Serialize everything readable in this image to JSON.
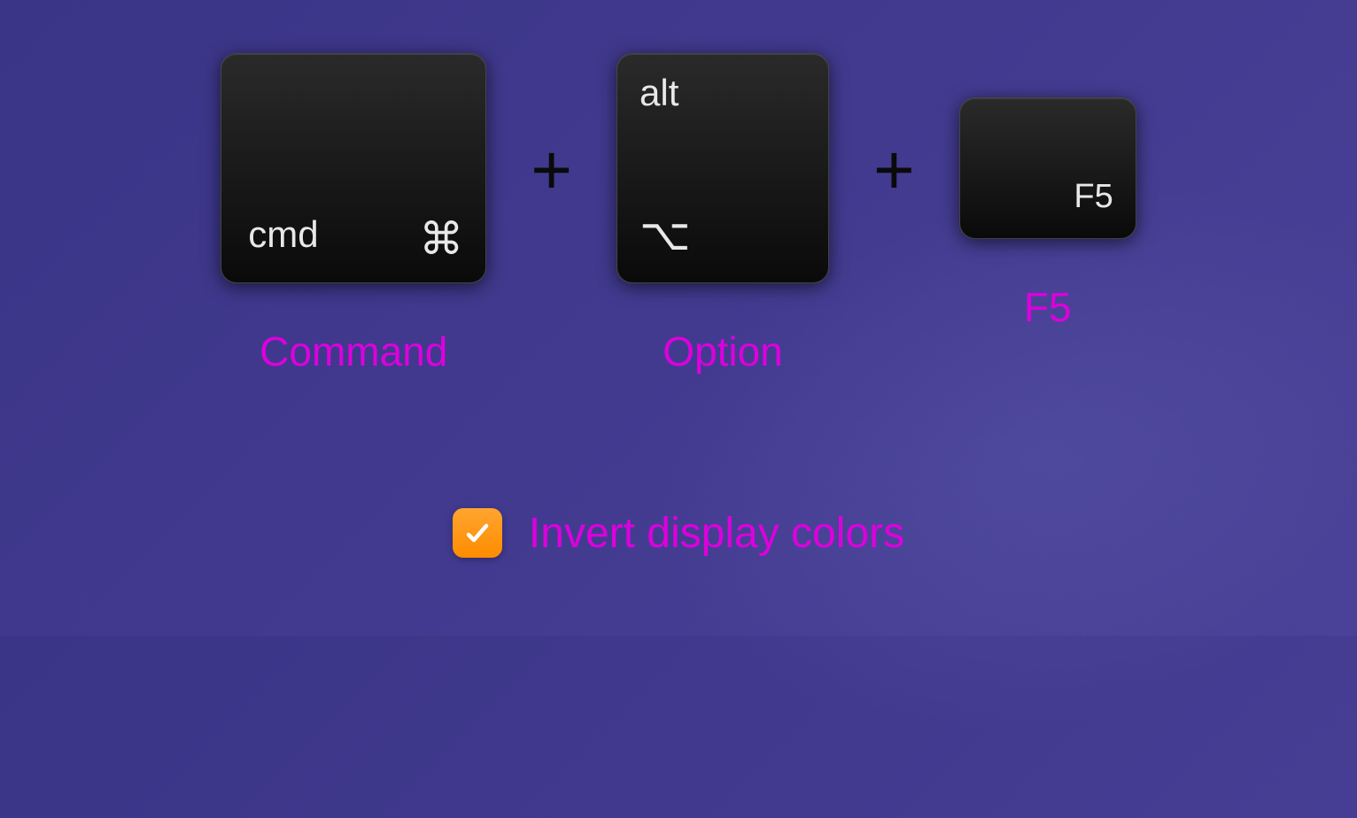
{
  "keys": {
    "command": {
      "text": "cmd",
      "symbol": "⌘",
      "label": "Command"
    },
    "option": {
      "text": "alt",
      "symbol": "⌥",
      "label": "Option"
    },
    "f5": {
      "text": "F5",
      "label": "F5"
    }
  },
  "separator": "+",
  "checkbox": {
    "checked": true,
    "label": "Invert display colors"
  },
  "colors": {
    "magenta": "#dd00dd",
    "orange": "#ff8c00",
    "keyBg": "#0a0a0a"
  }
}
